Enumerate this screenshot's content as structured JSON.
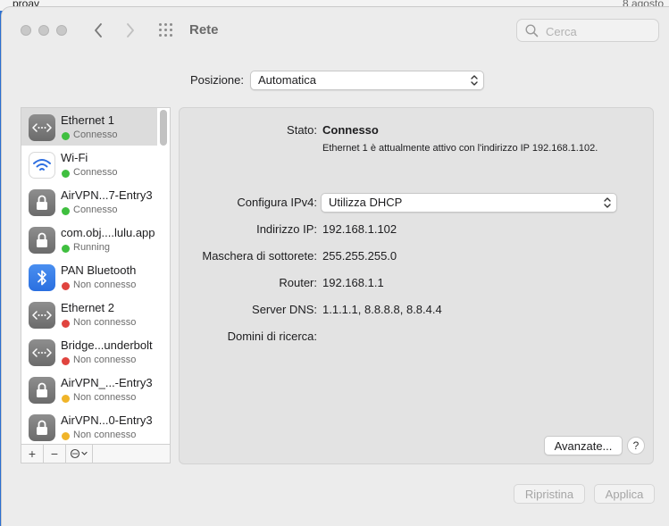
{
  "background": {
    "left_text": "proav",
    "right_text": "8 agosto"
  },
  "window": {
    "title": "Rete"
  },
  "search": {
    "placeholder": "Cerca"
  },
  "location": {
    "label": "Posizione:",
    "value": "Automatica"
  },
  "services": [
    {
      "name": "Ethernet 1",
      "status": "Connesso",
      "status_color": "#3fbf3f",
      "icon": "ethernet-icon",
      "selected": true
    },
    {
      "name": "Wi-Fi",
      "status": "Connesso",
      "status_color": "#3fbf3f",
      "icon": "wifi-icon",
      "selected": false
    },
    {
      "name": "AirVPN...7-Entry3",
      "status": "Connesso",
      "status_color": "#3fbf3f",
      "icon": "lock-icon",
      "selected": false
    },
    {
      "name": "com.obj....lulu.app",
      "status": "Running",
      "status_color": "#3fbf3f",
      "icon": "lock-icon",
      "selected": false
    },
    {
      "name": "PAN Bluetooth",
      "status": "Non connesso",
      "status_color": "#e0443e",
      "icon": "bluetooth-icon",
      "selected": false
    },
    {
      "name": "Ethernet 2",
      "status": "Non connesso",
      "status_color": "#e0443e",
      "icon": "ethernet-icon",
      "selected": false
    },
    {
      "name": "Bridge...underbolt",
      "status": "Non connesso",
      "status_color": "#e0443e",
      "icon": "ethernet-icon",
      "selected": false
    },
    {
      "name": "AirVPN_...-Entry3",
      "status": "Non connesso",
      "status_color": "#f0b429",
      "icon": "lock-icon",
      "selected": false
    },
    {
      "name": "AirVPN...0-Entry3",
      "status": "Non connesso",
      "status_color": "#f0b429",
      "icon": "lock-icon",
      "selected": false
    }
  ],
  "list_tools": {
    "add": "+",
    "remove": "−"
  },
  "details": {
    "status_label": "Stato:",
    "status_value": "Connesso",
    "status_desc": "Ethernet 1 è attualmente attivo con l'indirizzo IP 192.168.1.102.",
    "ipv4_label": "Configura IPv4:",
    "ipv4_value": "Utilizza DHCP",
    "ip_label": "Indirizzo IP:",
    "ip_value": "192.168.1.102",
    "mask_label": "Maschera di sottorete:",
    "mask_value": "255.255.255.0",
    "router_label": "Router:",
    "router_value": "192.168.1.1",
    "dns_label": "Server DNS:",
    "dns_value": "1.1.1.1, 8.8.8.8, 8.8.4.4",
    "domains_label": "Domini di ricerca:",
    "domains_value": ""
  },
  "buttons": {
    "advanced": "Avanzate...",
    "help": "?",
    "revert": "Ripristina",
    "apply": "Applica"
  }
}
